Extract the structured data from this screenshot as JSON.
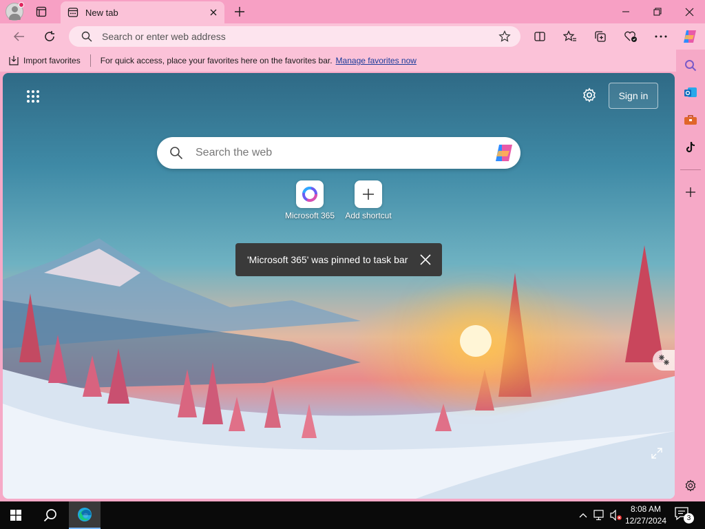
{
  "browser": {
    "tab": {
      "title": "New tab"
    },
    "address_bar": {
      "placeholder": "Search or enter web address"
    },
    "favorites_bar": {
      "import_label": "Import favorites",
      "message": "For quick access, place your favorites here on the favorites bar.",
      "manage_link": "Manage favorites now"
    }
  },
  "new_tab_page": {
    "signin_label": "Sign in",
    "search_placeholder": "Search the web",
    "shortcuts": [
      {
        "label": "Microsoft 365"
      },
      {
        "label": "Add shortcut"
      }
    ],
    "toast_message": "'Microsoft 365' was pinned to task bar"
  },
  "taskbar": {
    "time": "8:08 AM",
    "date": "12/27/2024",
    "notification_count": "3"
  },
  "colors": {
    "chrome_pink": "#f7a0c4",
    "toolbar_pink": "#fbc2d8",
    "link_blue": "#1a3a9a",
    "toast_bg": "#3a3a3a",
    "taskbar_bg": "#0a0a0a"
  },
  "icons": {
    "titlebar": [
      "profile-icon",
      "tab-actions-icon",
      "new-tab-page-icon",
      "close-tab-icon",
      "new-tab-plus-icon",
      "minimize-icon",
      "restore-icon",
      "window-close-icon"
    ],
    "toolbar": [
      "back-icon",
      "refresh-icon",
      "search-icon",
      "favorite-star-icon",
      "split-screen-icon",
      "favorites-icon",
      "collections-icon",
      "browser-essentials-icon",
      "more-icon",
      "copilot-icon"
    ],
    "sidebar": [
      "sidebar-search-icon",
      "outlook-icon",
      "tools-icon",
      "tiktok-icon",
      "add-icon",
      "sidebar-settings-icon"
    ],
    "taskbar": [
      "windows-start-icon",
      "taskbar-search-icon",
      "edge-icon",
      "chevron-up-icon",
      "network-icon",
      "volume-muted-icon",
      "notification-icon"
    ]
  }
}
